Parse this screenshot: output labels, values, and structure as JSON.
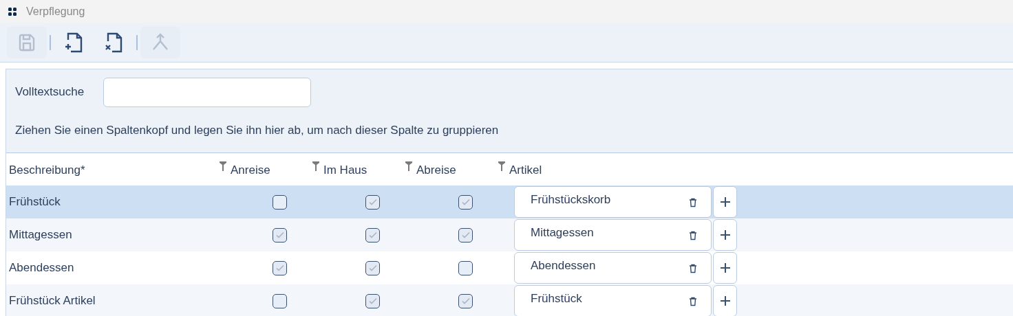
{
  "window": {
    "title": "Verpflegung"
  },
  "toolbar": [
    {
      "kind": "save",
      "disabled": true
    },
    {
      "kind": "new",
      "disabled": false
    },
    {
      "kind": "delete",
      "disabled": false
    },
    {
      "kind": "merge",
      "disabled": true
    }
  ],
  "search": {
    "label": "Volltextsuche"
  },
  "group_hint": "Ziehen Sie einen Spaltenkopf und legen Sie ihn hier ab, um nach dieser Spalte zu gruppieren",
  "table": {
    "columns": [
      {
        "label": "Beschreibung*",
        "filter": false
      },
      {
        "label": "Anreise",
        "filter": true
      },
      {
        "label": "Im Haus",
        "filter": true
      },
      {
        "label": "Abreise",
        "filter": true
      },
      {
        "label": "Artikel",
        "filter": true
      }
    ],
    "rows": [
      {
        "name": "Frühstück",
        "selected": true,
        "anreise": false,
        "im_haus": true,
        "abreise": true,
        "artikel": "Frühstückskorb"
      },
      {
        "name": "Mittagessen",
        "selected": false,
        "anreise": true,
        "im_haus": true,
        "abreise": true,
        "artikel": "Mittagessen"
      },
      {
        "name": "Abendessen",
        "selected": false,
        "anreise": true,
        "im_haus": true,
        "abreise": false,
        "artikel": "Abendessen"
      },
      {
        "name": "Frühstück Artikel",
        "selected": false,
        "anreise": false,
        "im_haus": true,
        "abreise": true,
        "artikel": "Frühstück"
      }
    ]
  }
}
